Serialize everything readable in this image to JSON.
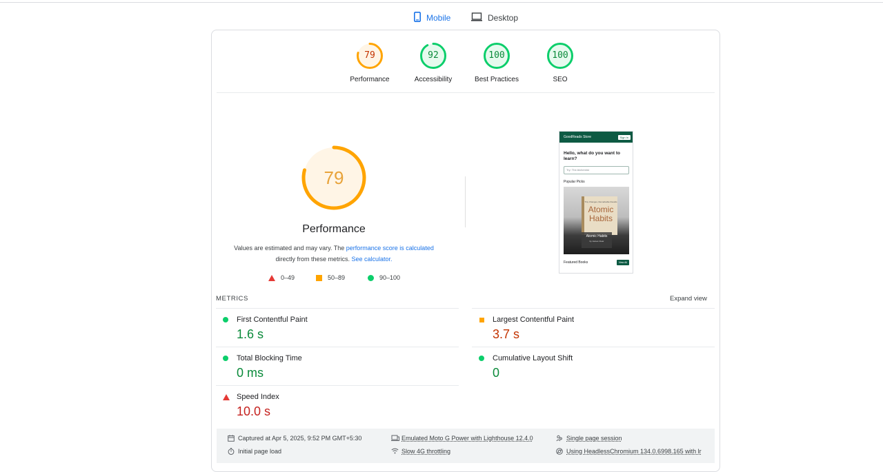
{
  "tabs": [
    {
      "label": "Mobile",
      "icon": "phone-icon",
      "active": true
    },
    {
      "label": "Desktop",
      "icon": "laptop-icon",
      "active": false
    }
  ],
  "gauges": [
    {
      "score": "79",
      "label": "Performance",
      "value": 0.79,
      "color": "#ffa400",
      "text_color": "#c33300"
    },
    {
      "score": "92",
      "label": "Accessibility",
      "value": 0.92,
      "color": "#0cce6b",
      "text_color": "#0a8a3a"
    },
    {
      "score": "100",
      "label": "Best Practices",
      "value": 1.0,
      "color": "#0cce6b",
      "text_color": "#0a8a3a"
    },
    {
      "score": "100",
      "label": "SEO",
      "value": 1.0,
      "color": "#0cce6b",
      "text_color": "#0a8a3a"
    }
  ],
  "performance": {
    "score": "79",
    "value": 0.79,
    "title": "Performance",
    "desc_prefix": "Values are estimated and may vary. The ",
    "desc_link": "performance score is calculated",
    "desc_mid": "directly from these metrics. ",
    "desc_link2": "See calculator.",
    "legend": [
      {
        "range": "0–49",
        "shape": "triangle",
        "color": "#e53935"
      },
      {
        "range": "50–89",
        "shape": "square",
        "color": "#ffa400"
      },
      {
        "range": "90–100",
        "shape": "circle",
        "color": "#0cce6b"
      }
    ]
  },
  "screenshot": {
    "brand": "GoodReads Store",
    "signin": "Sign In",
    "hello": "Hello, what do you want to learn?",
    "search_placeholder": "Try: The Alchemist",
    "popular": "Popular Picks",
    "cover_tagline": "Tiny Changes, Remarkable Results",
    "cover_title": "Atomic Habits",
    "caption_title": "Atomic Habits",
    "caption_author": "by James Clear",
    "featured": "Featured Books",
    "view_all": "View All"
  },
  "metrics": {
    "label": "METRICS",
    "expand": "Expand view",
    "items": [
      {
        "title": "First Contentful Paint",
        "value": "1.6 s",
        "status": "good"
      },
      {
        "title": "Largest Contentful Paint",
        "value": "3.7 s",
        "status": "average"
      },
      {
        "title": "Total Blocking Time",
        "value": "0 ms",
        "status": "good"
      },
      {
        "title": "Cumulative Layout Shift",
        "value": "0",
        "status": "good"
      },
      {
        "title": "Speed Index",
        "value": "10.0 s",
        "status": "poor"
      }
    ]
  },
  "footer": {
    "captured": "Captured at Apr 5, 2025, 9:52 PM GMT+5:30",
    "initial": "Initial page load",
    "emulated": "Emulated Moto G Power with Lighthouse 12.4.0",
    "throttling": "Slow 4G throttling",
    "session": "Single page session",
    "browser": "Using HeadlessChromium 134.0.6998.165 with lr"
  }
}
